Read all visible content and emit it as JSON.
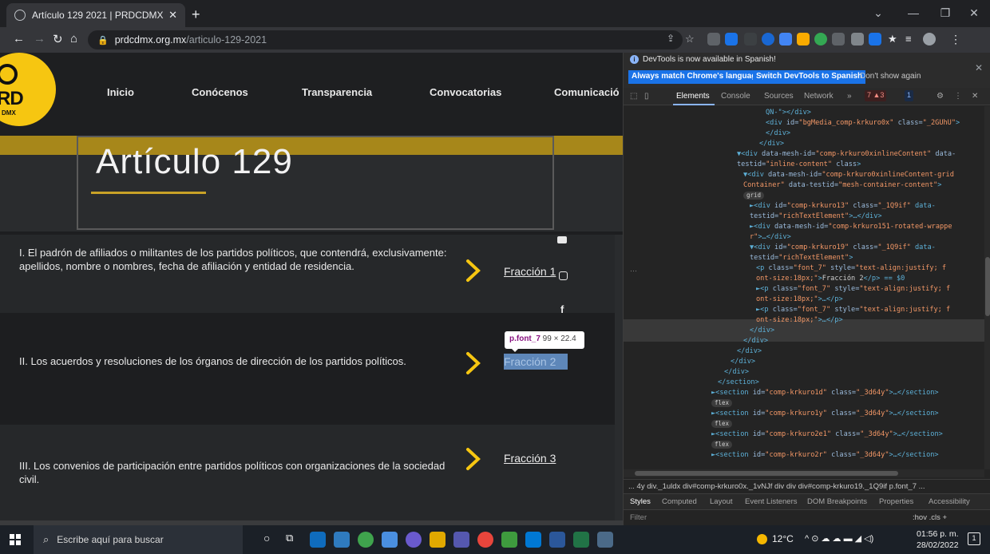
{
  "browser": {
    "tab_title": "Artículo 129 2021 | PRDCDMX",
    "url_host": "prdcdmx.org.mx",
    "url_path": "/articulo-129-2021"
  },
  "site": {
    "logo_text": "RD",
    "logo_sub": "DMX",
    "nav": [
      "Inicio",
      "Conócenos",
      "Transparencia",
      "Convocatorias",
      "Comunicació"
    ],
    "hero_title": "Artículo 129",
    "rows": [
      {
        "text": "I. El padrón de afiliados o militantes de los partidos políticos, que contendrá, exclusivamente: apellidos, nombre o nombres, fecha de afiliación y entidad de residencia.",
        "link": "Fracción 1"
      },
      {
        "text": "II. Los acuerdos y resoluciones de los órganos de dirección de los partidos políticos.",
        "link": "Fracción 2"
      },
      {
        "text": "III. Los convenios de participación entre partidos políticos con organizaciones de la sociedad civil.",
        "link": "Fracción 3"
      }
    ],
    "tooltip_selector": "p.font_7",
    "tooltip_size": "99 × 22.4",
    "accent_color": "#f6c611"
  },
  "devtools": {
    "info_message": "DevTools is now available in Spanish!",
    "btn_match": "Always match Chrome's language",
    "btn_switch": "Switch DevTools to Spanish",
    "btn_dont_show": "Don't show again",
    "tabs": [
      "Elements",
      "Console",
      "Sources",
      "Network",
      "»"
    ],
    "issues_badge": "7 ▲3",
    "messages_badge": "1",
    "breadcrumbs": "... 4y   div._1uldx   div#comp-krkuro0x._1vNJf   div   div   div#comp-krkuro19._1Q9if   p.font_7   ...",
    "subtabs": [
      "Styles",
      "Computed",
      "Layout",
      "Event Listeners",
      "DOM Breakpoints",
      "Properties",
      "Accessibility"
    ],
    "filter_placeholder": "Filter",
    "filter_tools": ":hov  .cls  +",
    "code_lines": [
      {
        "tag": "QN-\"></div>"
      },
      {
        "tag": "<div ",
        "attr": "id=",
        "val": "\"bgMedia_comp-krkuro0x\"",
        "attr2": " class=",
        "val2": "\"_2GUhU\"",
        "end": ">"
      },
      {
        "tag": "</div>"
      },
      {
        "tag": "</div>"
      },
      {
        "tag": "▼<div ",
        "attr": "data-mesh-id=",
        "val": "\"comp-krkuro0xinlineContent\"",
        "attr2": " data-",
        "val2": "",
        "end": ""
      },
      {
        "tag": "",
        "attr": "testid=",
        "val": "\"inline-content\"",
        "attr2": " class",
        "val2": "",
        "end": ">"
      },
      {
        "tag": "▼<div ",
        "attr": "data-mesh-id=",
        "val": "\"comp-krkuro0xinlineContent-grid",
        "end": ""
      },
      {
        "tag": "",
        "attr": "",
        "val": "Container\"",
        "attr2": " data-testid=",
        "val2": "\"mesh-container-content\"",
        "end": ">"
      },
      {
        "pill": "grid"
      },
      {
        "tag": "►<div ",
        "attr": "id=",
        "val": "\"comp-krkuro13\"",
        "attr2": " class=",
        "val2": "\"_1Q9if\"",
        "end": " data-"
      },
      {
        "tag": "",
        "attr": "testid=",
        "val": "\"richTextElement\"",
        "end": ">…</div>"
      },
      {
        "tag": "►<div ",
        "attr": "data-mesh-id=",
        "val": "\"comp-krkuro151-rotated-wrappe",
        "end": ""
      },
      {
        "tag": "",
        "attr": "",
        "val": "r\"",
        "end": ">…</div>"
      },
      {
        "tag": "▼<div ",
        "attr": "id=",
        "val": "\"comp-krkuro19\"",
        "attr2": " class=",
        "val2": "\"_1Q9if\"",
        "end": " data-"
      },
      {
        "tag": "",
        "attr": "testid=",
        "val": "\"richTextElement\"",
        "end": ">"
      },
      {
        "tag": "<p ",
        "attr": "class=",
        "val": "\"font_7\"",
        "attr2": " style=",
        "val2": "\"text-align:justify; f",
        "end": ""
      },
      {
        "tag": "",
        "attr": "",
        "val": "ont-size:18px;\"",
        "end": ">",
        "tx": "Fracción 2",
        "close": "</p> == $0"
      },
      {
        "tag": "►<p ",
        "attr": "class=",
        "val": "\"font_7\"",
        "attr2": " style=",
        "val2": "\"text-align:justify; f",
        "end": ""
      },
      {
        "tag": "",
        "attr": "",
        "val": "ont-size:18px;\"",
        "end": ">…</p>"
      },
      {
        "tag": "►<p ",
        "attr": "class=",
        "val": "\"font_7\"",
        "attr2": " style=",
        "val2": "\"text-align:justify; f",
        "end": ""
      },
      {
        "tag": "",
        "attr": "",
        "val": "ont-size:18px;\"",
        "end": ">…</p>"
      },
      {
        "tag": "</div>"
      },
      {
        "tag": "</div>"
      },
      {
        "tag": "</div>"
      },
      {
        "tag": "</div>"
      },
      {
        "tag": "</div>"
      },
      {
        "tag": "</section>"
      },
      {
        "tag": "►<section ",
        "attr": "id=",
        "val": "\"comp-krkuro1d\"",
        "attr2": " class=",
        "val2": "\"_3d64y\"",
        "end": ">…</section>"
      },
      {
        "pill": "flex"
      },
      {
        "tag": "►<section ",
        "attr": "id=",
        "val": "\"comp-krkuro1y\"",
        "attr2": " class=",
        "val2": "\"_3d64y\"",
        "end": ">…</section>"
      },
      {
        "pill": "flex"
      },
      {
        "tag": "►<section ",
        "attr": "id=",
        "val": "\"comp-krkuro2e1\"",
        "attr2": " class=",
        "val2": "\"_3d64y\"",
        "end": ">…</section>"
      },
      {
        "pill": "flex"
      },
      {
        "tag": "►<section ",
        "attr": "id=",
        "val": "\"comp-krkuro2r\"",
        "attr2": " class=",
        "val2": "\"_3d64y\"",
        "end": ">…</section>"
      }
    ]
  },
  "taskbar": {
    "search_placeholder": "Escribe aquí para buscar",
    "weather": "12°C",
    "time": "01:56 p. m.",
    "date": "28/02/2022",
    "notifications": "1"
  }
}
